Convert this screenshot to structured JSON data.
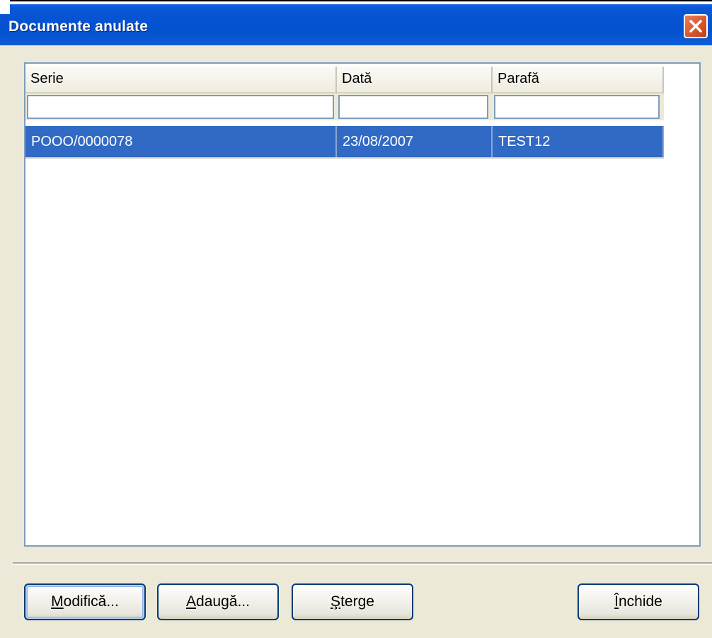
{
  "window": {
    "title": "Documente anulate"
  },
  "grid": {
    "columns": [
      {
        "label": "Serie"
      },
      {
        "label": "Dată"
      },
      {
        "label": "Parafă"
      }
    ],
    "filters": [
      "",
      "",
      ""
    ],
    "rows": [
      {
        "serie": "POOO/0000078",
        "data": "23/08/2007",
        "parafa": "TEST12",
        "selected": true
      }
    ]
  },
  "buttons": {
    "modify_mnemonic": "M",
    "modify_rest": "odifică...",
    "add_mnemonic": "A",
    "add_rest": "daugă...",
    "delete_mnemonic": "Ş",
    "delete_rest": "terge",
    "close_mnemonic": "Î",
    "close_rest": "nchide"
  },
  "colors": {
    "titlebar": "#0553d2",
    "selection": "#316ac5",
    "window_bg": "#ece9d8",
    "border": "#7f9db9",
    "close_button": "#d9572e"
  },
  "icons": {
    "close": "close-x-icon"
  }
}
